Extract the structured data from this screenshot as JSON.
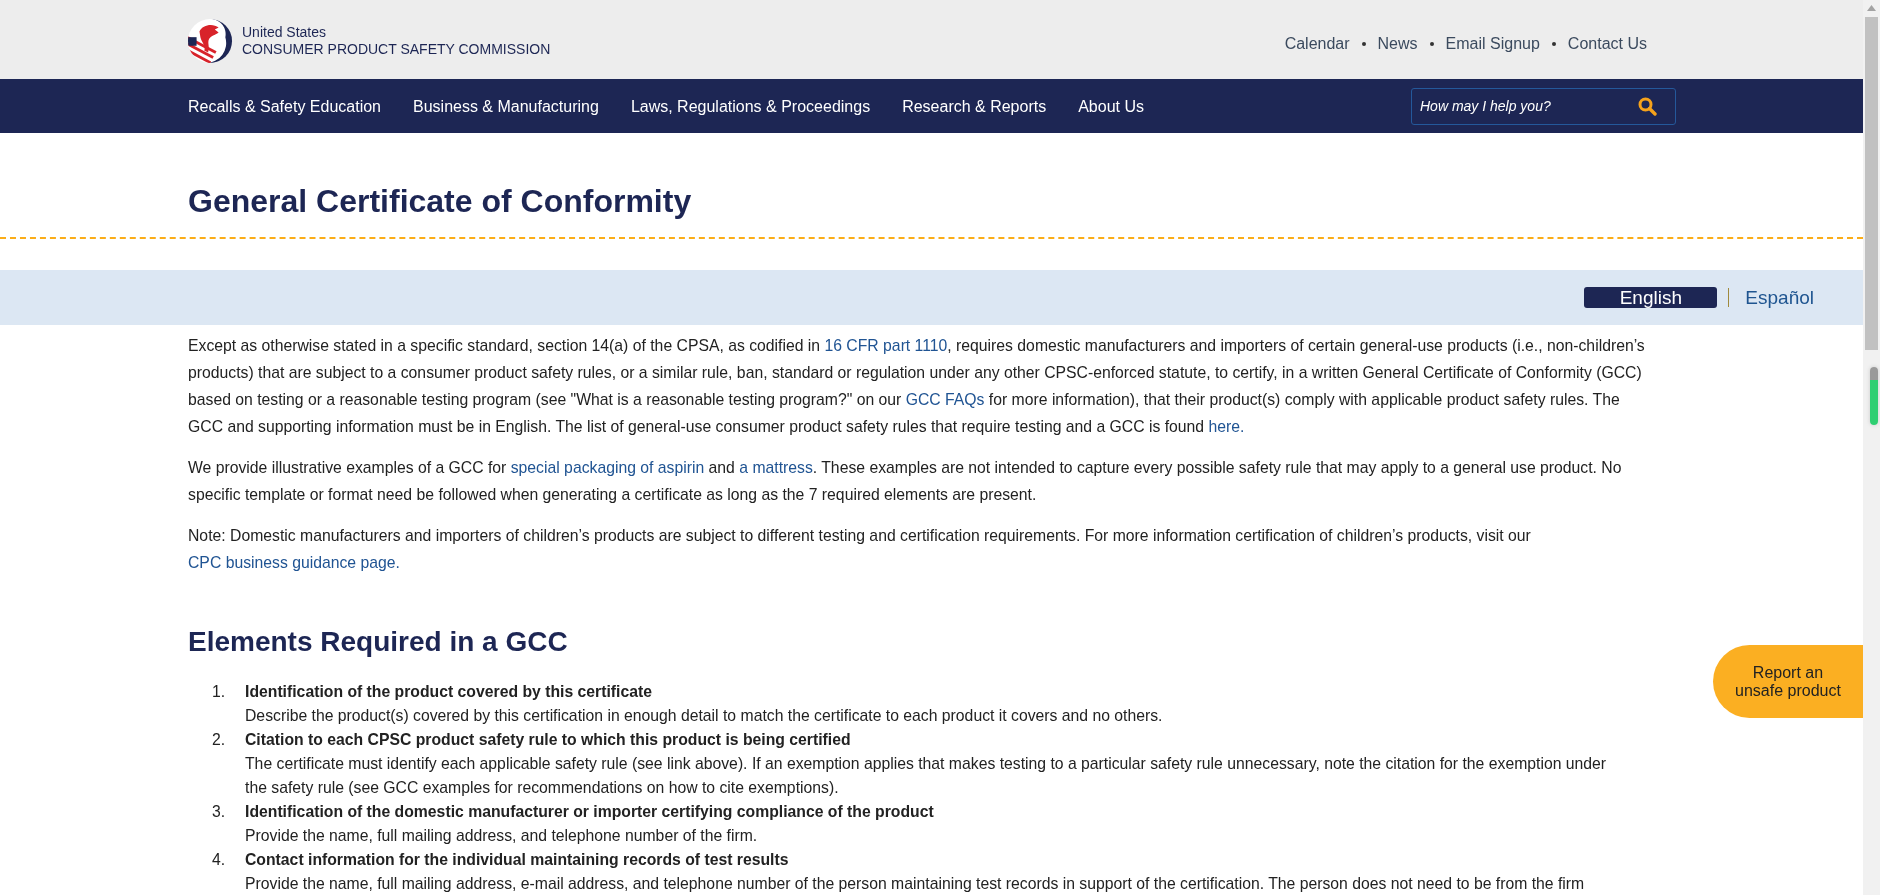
{
  "header": {
    "logo": {
      "line_1": "United States",
      "line_2": "CONSUMER PRODUCT SAFETY COMMISSION"
    },
    "utility_links": [
      "Calendar",
      "News",
      "Email Signup",
      "Contact Us"
    ]
  },
  "nav": {
    "items": [
      "Recalls & Safety Education",
      "Business & Manufacturing",
      "Laws, Regulations & Proceedings",
      "Research & Reports",
      "About Us"
    ],
    "search": {
      "placeholder": "How may I help you?"
    }
  },
  "page_title": "General Certificate of Conformity",
  "languages": [
    {
      "label": "English",
      "selected": true
    },
    {
      "label": "Español",
      "selected": false
    }
  ],
  "intro_paragraphs": [
    [
      {
        "kind": "text",
        "text": "Except as otherwise stated in a specific standard, section 14(a) of the CPSA, as codified in "
      },
      {
        "kind": "link",
        "text": "16 CFR part 1110"
      },
      {
        "kind": "text",
        "text": ", requires domestic manufacturers and importers of certain general-use products (i.e., non-children’s products) that are subject to a consumer product safety rules, or a similar rule, ban, standard or regulation under any other CPSC-enforced statute, to certify, in a written General Certificate of Conformity (GCC) based on testing or a reasonable testing program (see \"What is a reasonable testing program?\" on our "
      },
      {
        "kind": "link",
        "text": "GCC FAQs"
      },
      {
        "kind": "text",
        "text": " for more information), that their product(s) comply with applicable product safety rules. The GCC and supporting information must be in English. The list of general-use consumer product safety rules that require testing and a GCC is found "
      },
      {
        "kind": "link",
        "text": "here."
      }
    ],
    [
      {
        "kind": "text",
        "text": "We provide illustrative examples of a GCC for "
      },
      {
        "kind": "link",
        "text": "special packaging of aspirin"
      },
      {
        "kind": "text",
        "text": " and "
      },
      {
        "kind": "link",
        "text": "a mattress"
      },
      {
        "kind": "text",
        "text": ". These examples are not intended to capture every possible safety rule that may apply to a general use product. No specific template or format need be followed when generating a certificate as long as the 7 required elements are present."
      }
    ],
    [
      {
        "kind": "text",
        "text": "Note: Domestic manufacturers and importers of children’s products are subject to different testing and certification requirements. For more information certification of children’s products, visit our "
      },
      {
        "kind": "link",
        "text": "CPC business guidance page."
      }
    ]
  ],
  "section_heading": "Elements Required in a GCC",
  "elements": [
    {
      "number": "1.",
      "title": "Identification of the product covered by this certificate",
      "description": "Describe the product(s) covered by this certification in enough detail to match the certificate to each product it covers and no others."
    },
    {
      "number": "2.",
      "title": "Citation to each CPSC product safety rule to which this product is being certified",
      "description": "The certificate must identify each applicable safety rule (see link above). If an exemption applies that makes testing to a particular safety rule unnecessary, note the citation for the exemption under the safety rule (see GCC examples for recommendations on how to cite exemptions)."
    },
    {
      "number": "3.",
      "title": "Identification of the domestic manufacturer or importer certifying compliance of the product",
      "description": "Provide the name, full mailing address, and telephone number of the firm."
    },
    {
      "number": "4.",
      "title": "Contact information for the individual maintaining records of test results",
      "description": "Provide the name, full mailing address, e-mail address, and telephone number of the person maintaining test records in support of the certification. The person does not need to be from the firm"
    }
  ],
  "report_button": "Report an unsafe product"
}
